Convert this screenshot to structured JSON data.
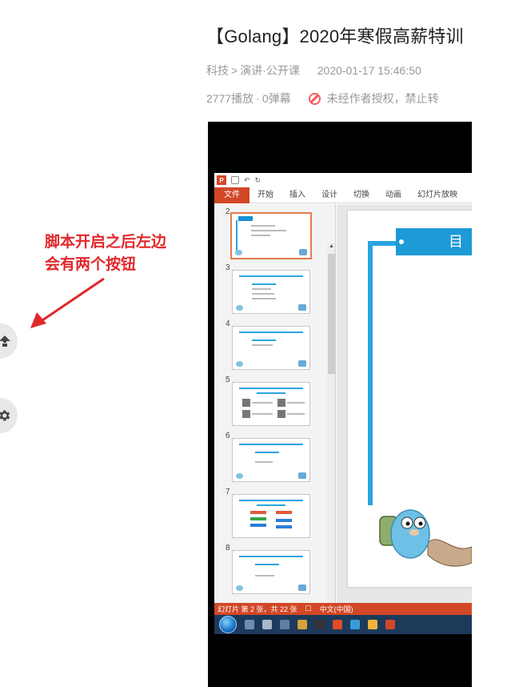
{
  "video": {
    "title": "【Golang】2020年寒假高薪特训",
    "category": "科技",
    "separator": ">",
    "subcategory": "演讲·公开课",
    "published": "2020-01-17 15:46:50",
    "plays": "2777播放",
    "danmaku": "0弹幕",
    "dot_sep": "·",
    "copyright_notice": "未经作者授权，禁止转"
  },
  "annotation": {
    "line1": "脚本开启之后左边",
    "line2": "会有两个按钮",
    "color": "#e0282b"
  },
  "side_buttons": [
    {
      "icon": "upload-icon"
    },
    {
      "icon": "gear-icon"
    }
  ],
  "ppt": {
    "app_logo": "P",
    "tabs": [
      "文件",
      "开始",
      "插入",
      "设计",
      "切换",
      "动画",
      "幻灯片放映"
    ],
    "thumbnail_numbers": [
      "2",
      "3",
      "4",
      "5",
      "6",
      "7",
      "8"
    ],
    "active_slide": "2",
    "main_slide_title": "目",
    "status_text": "幻灯片 第 2 张，共 22 张",
    "language": "中文(中国)",
    "accent_color": "#d24726"
  }
}
